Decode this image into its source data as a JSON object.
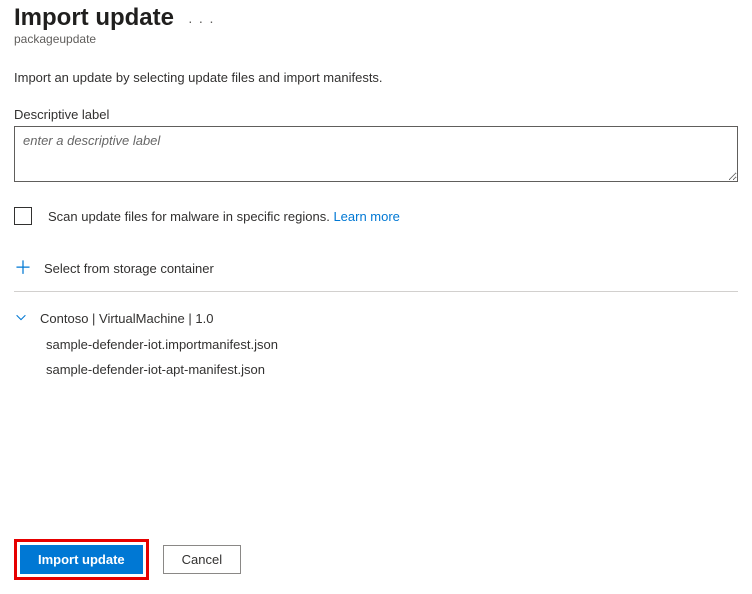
{
  "header": {
    "title": "Import update",
    "subtitle": "packageupdate"
  },
  "intro": "Import an update by selecting update files and import manifests.",
  "form": {
    "descriptive_label": "Descriptive label",
    "descriptive_placeholder": "enter a descriptive label"
  },
  "scan": {
    "label": "Scan update files for malware in specific regions.",
    "link": "Learn more"
  },
  "storage": {
    "select_label": "Select from storage container"
  },
  "group": {
    "title": "Contoso | VirtualMachine | 1.0",
    "files": [
      "sample-defender-iot.importmanifest.json",
      "sample-defender-iot-apt-manifest.json"
    ]
  },
  "footer": {
    "primary": "Import update",
    "secondary": "Cancel"
  }
}
